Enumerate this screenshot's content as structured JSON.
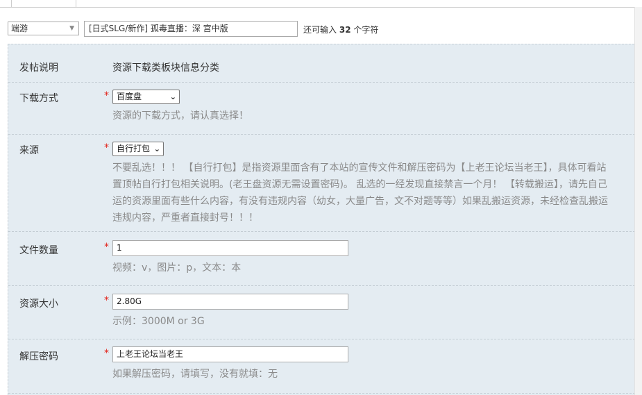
{
  "subject": {
    "type_value": "端游",
    "title_value": "[日式SLG/新作] 孤毒直播：深 宫中版",
    "remain_prefix": "还可输入",
    "remain_count": "32",
    "remain_suffix": "个字符"
  },
  "fields": {
    "post_note": {
      "label": "发帖说明",
      "value": "资源下载类板块信息分类"
    },
    "download_method": {
      "label": "下载方式",
      "required": "*",
      "selected": "百度盘",
      "hint": "资源的下载方式，请认真选择！"
    },
    "source": {
      "label": "来源",
      "required": "*",
      "selected": "自行打包",
      "notice_lines": [
        "不要乱选！！！ 【自行打包】是指资源里面含有了本站的宣传文件和解压密码为【上老王论坛当老王】，具体可看站",
        "置顶帖自行打包相关说明。(老王盘资源无需设置密码)。 乱选的一经发现直接禁言一个月！ 【转载搬运】，请先自己",
        "运的资源里面有些什么内容，有没有违规内容（幼女，大量广告，文不对题等等）如果乱搬运资源，未经检查乱搬运",
        "违规内容，严重者直接封号！！！"
      ]
    },
    "file_count": {
      "label": "文件数量",
      "required": "*",
      "value": "1",
      "hint": "视频：v，图片：p，文本：本"
    },
    "resource_size": {
      "label": "资源大小",
      "required": "*",
      "value": "2.80G",
      "hint": "示例：3000M or 3G"
    },
    "unzip_password": {
      "label": "解压密码",
      "required": "*",
      "value": "上老王论坛当老王",
      "hint": "如果解压密码，请填写，没有就填：无"
    }
  },
  "colors": {
    "panel_bg": "#e4ecf2",
    "required": "#e2231a",
    "hint": "#8a8a8a"
  }
}
